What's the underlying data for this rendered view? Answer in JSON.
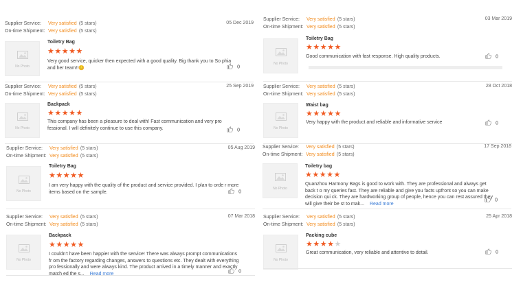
{
  "labels": {
    "supplier_service": "Supplier Service:",
    "ontime_shipment": "On-time Shipment:",
    "no_photo": "No Photo"
  },
  "colors": {
    "rating_text": "#f28a1a",
    "star_filled": "#f05a22",
    "star_empty": "#cfcfcf",
    "link": "#3a7bd5"
  },
  "reviews": [
    {
      "supplier_value": "Very satisfied",
      "supplier_stars": "(5 stars)",
      "shipment_value": "Very satisfied",
      "shipment_stars": "(5 stars)",
      "date": "05 Dec 2019",
      "product": "Toiletry Bag",
      "rating": 5,
      "text": "Very good service, quicker then expected with a good quality. Big thank you to So phia and her team!!😊",
      "likes": "0"
    },
    {
      "supplier_value": "Very satisfied",
      "supplier_stars": "(5 stars)",
      "shipment_value": "Very satisfied",
      "shipment_stars": "(5 stars)",
      "date": "03 Mar 2019",
      "product": "Toiletry Bag",
      "rating": 5,
      "text": "Good communication with fast response. High quality products.",
      "likes": "0"
    },
    {
      "supplier_value": "Very satisfied",
      "supplier_stars": "(5 stars)",
      "shipment_value": "Very satisfied",
      "shipment_stars": "(5 stars)",
      "date": "25 Sep 2019",
      "product": "Backpack",
      "rating": 5,
      "text": "This company has been a pleasure to deal with! Fast communication and very pro fessional. I will definitely continue to use this company.",
      "likes": "0"
    },
    {
      "supplier_value": "Very satisfied",
      "supplier_stars": "(5 stars)",
      "shipment_value": "Very satisfied",
      "shipment_stars": "(5 stars)",
      "date": "28 Oct 2018",
      "product": "Waist bag",
      "rating": 5,
      "text": "Very happy with the product and reliable and informative service",
      "likes": "0"
    },
    {
      "supplier_value": "Very satisfied",
      "supplier_stars": "(5 stars)",
      "shipment_value": "Very satisfied",
      "shipment_stars": "(5 stars)",
      "date": "05 Aug 2019",
      "product": "Toiletry Bag",
      "rating": 5,
      "text": "I am very happy with the quality of the product and service provided. I plan to orde r more items based on the sample.",
      "likes": "0"
    },
    {
      "supplier_value": "Very satisfied",
      "supplier_stars": "(5 stars)",
      "shipment_value": "Very satisfied",
      "shipment_stars": "(5 stars)",
      "date": "17 Sep 2018",
      "product": "Toiletry bag",
      "rating": 5,
      "text": "Quanzhou Harmony Bags is good to work with. They are professional and always get back t o my queries fast. They are reliable and give you facts upfront so you can make decision qui ck. They are hardworking group of people, hence you can rest assured they will give their be st to mak...",
      "read_more": "Read more",
      "likes": "0"
    },
    {
      "supplier_value": "Very satisfied",
      "supplier_stars": "(5 stars)",
      "shipment_value": "Very satisfied",
      "shipment_stars": "(5 stars)",
      "date": "07 Mar 2018",
      "product": "Backpack",
      "rating": 5,
      "text": "I couldn't have been happier with the service! There was always prompt communications fr om the factory regarding changes, answers to questions etc. They dealt with everything pro fessionally and were always kind. The product arrived in a timely manner and exactly match ed the s...",
      "read_more": "Read more",
      "likes": "0"
    },
    {
      "supplier_value": "Very satisfied",
      "supplier_stars": "(5 stars)",
      "shipment_value": "Very satisfied",
      "shipment_stars": "(5 stars)",
      "date": "25 Apr 2018",
      "product": "Packing cube",
      "rating": 4,
      "text": "Great communication, very reliable and attentive to detail.",
      "likes": "0"
    }
  ]
}
